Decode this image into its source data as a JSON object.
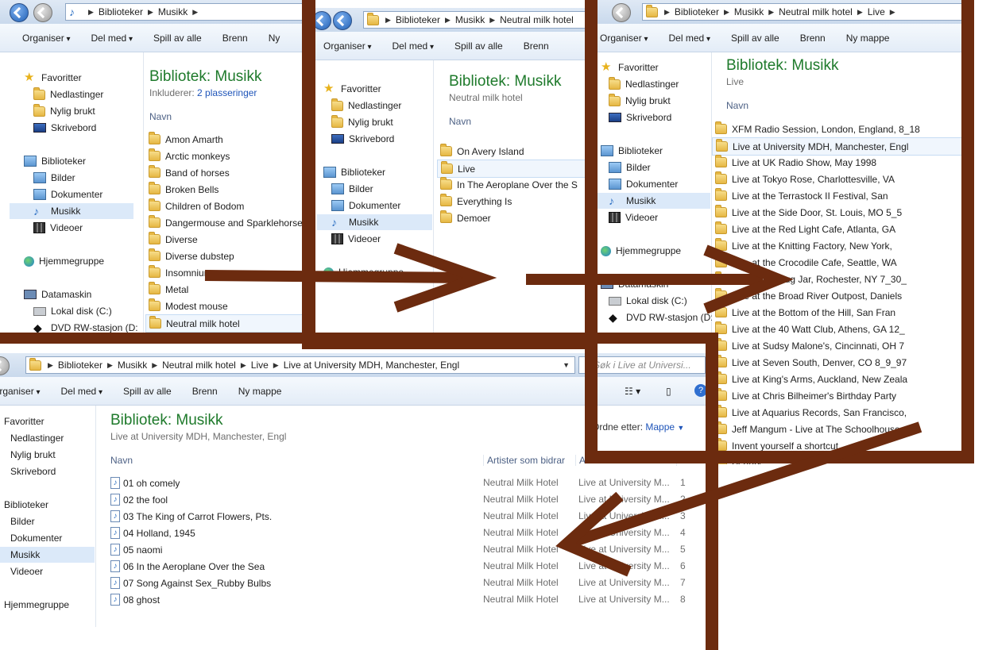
{
  "colors": {
    "frame": "#6c2b0f",
    "library_title": "#1e7a2b",
    "link": "#1f55b9"
  },
  "toolbar": {
    "organize": "Organiser",
    "share": "Del med",
    "play_all": "Spill av alle",
    "burn": "Brenn",
    "new_folder": "Ny mappe",
    "new_folder_cut": "Ny"
  },
  "nav": {
    "favorites": "Favoritter",
    "downloads": "Nedlastinger",
    "recent": "Nylig brukt",
    "desktop": "Skrivebord",
    "libraries": "Biblioteker",
    "pictures": "Bilder",
    "documents": "Dokumenter",
    "music": "Musikk",
    "videos": "Videoer",
    "homegroup": "Hjemmegruppe",
    "computer": "Datamaskin",
    "local_disk": "Lokal disk (C:)",
    "dvd": "DVD RW-stasjon (D:)",
    "dvd_cut": "DVD RW-stasjon (D:"
  },
  "library_title": "Bibliotek: Musikk",
  "name_col": "Navn",
  "win1": {
    "breadcrumb": [
      "Biblioteker",
      "Musikk"
    ],
    "includes_label": "Inkluderer:",
    "includes_link": "2 plasseringer",
    "folders": [
      "Amon Amarth",
      "Arctic monkeys",
      "Band of horses",
      "Broken Bells",
      "Children of Bodom",
      "Dangermouse and Sparklehorse",
      "Diverse",
      "Diverse dubstep",
      "Insomnium",
      "Metal",
      "Modest mouse",
      "Neutral milk hotel"
    ]
  },
  "win2": {
    "breadcrumb": [
      "Biblioteker",
      "Musikk",
      "Neutral milk hotel"
    ],
    "subtitle": "Neutral milk hotel",
    "folders": [
      "On Avery Island",
      "Live",
      "In The Aeroplane Over the S",
      "Everything Is",
      "Demoer"
    ]
  },
  "win3": {
    "breadcrumb": [
      "Biblioteker",
      "Musikk",
      "Neutral milk hotel",
      "Live"
    ],
    "subtitle": "Live",
    "folders": [
      "XFM Radio Session, London, England, 8_18",
      "Live at University MDH, Manchester, Engl",
      "Live at UK Radio Show, May 1998",
      "Live at Tokyo Rose, Charlottesville, VA",
      "Live at the Terrastock II Festival, San",
      "Live at the Side Door, St. Louis, MO 5_5",
      "Live at the Red Light Cafe, Atlanta, GA",
      "Live at the Knitting Factory, New York,",
      "Live at the Crocodile Cafe, Seattle, WA",
      "Live at the Bug Jar, Rochester, NY 7_30_",
      "Live at the Broad River Outpost, Daniels",
      "Live at the Bottom of the Hill, San Fran",
      "Live at the 40 Watt Club, Athens, GA 12_",
      "Live at Sudsy Malone's, Cincinnati, OH 7",
      "Live at Seven South, Denver, CO 8_9_97",
      "Live at King's Arms, Auckland, New Zeala",
      "Live at Chris Bilheimer's Birthday Party",
      "Live at Aquarius Records, San Francisco,",
      "Jeff Mangum - Live at The Schoolhouse",
      "Invent yourself a shortcut",
      "Beauty"
    ]
  },
  "win4": {
    "breadcrumb": [
      "Biblioteker",
      "Musikk",
      "Neutral milk hotel",
      "Live",
      "Live at University MDH, Manchester, Engl"
    ],
    "search_placeholder": "Søk i Live at Universi...",
    "subtitle": "Live at University MDH, Manchester, Engl",
    "arrange_label": "Ordne etter:",
    "arrange_value": "Mappe",
    "columns": {
      "name": "Navn",
      "artists": "Artister som bidrar",
      "album": "Album",
      "track": "#"
    },
    "tracks": [
      {
        "title": "01 oh comely",
        "artist": "Neutral Milk Hotel",
        "album": "Live at University M...",
        "num": "1"
      },
      {
        "title": "02 the fool",
        "artist": "Neutral Milk Hotel",
        "album": "Live at University M...",
        "num": "2"
      },
      {
        "title": "03 The King of Carrot Flowers, Pts.",
        "artist": "Neutral Milk Hotel",
        "album": "Live at University M...",
        "num": "3"
      },
      {
        "title": "04 Holland, 1945",
        "artist": "Neutral Milk Hotel",
        "album": "Live at University M...",
        "num": "4"
      },
      {
        "title": "05 naomi",
        "artist": "Neutral Milk Hotel",
        "album": "Live at University M...",
        "num": "5"
      },
      {
        "title": "06 In the Aeroplane Over the Sea",
        "artist": "Neutral Milk Hotel",
        "album": "Live at University M...",
        "num": "6"
      },
      {
        "title": "07 Song Against Sex_Rubby Bulbs",
        "artist": "Neutral Milk Hotel",
        "album": "Live at University M...",
        "num": "7"
      },
      {
        "title": "08 ghost",
        "artist": "Neutral Milk Hotel",
        "album": "Live at University M...",
        "num": "8"
      }
    ]
  }
}
